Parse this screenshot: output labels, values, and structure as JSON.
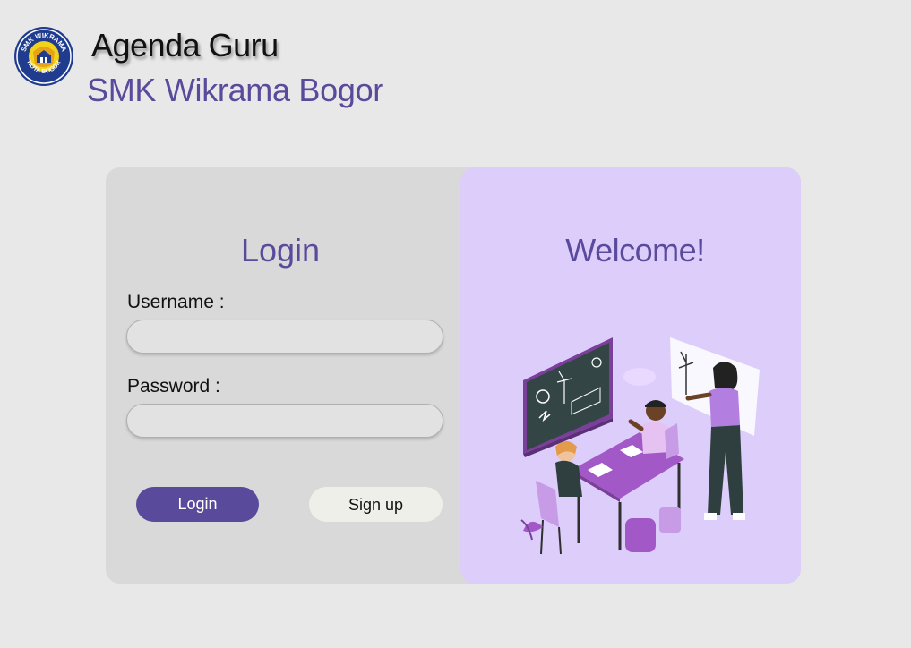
{
  "header": {
    "app_title": "Agenda Guru",
    "school_name": "SMK Wikrama Bogor",
    "logo_top_text": "SMK WIKRAMA",
    "logo_bottom_text": "KOTA BOGOR"
  },
  "login_panel": {
    "heading": "Login",
    "username_label": "Username :",
    "username_value": "",
    "password_label": "Password :",
    "password_value": "",
    "login_button": "Login",
    "signup_button": "Sign up"
  },
  "welcome_panel": {
    "heading": "Welcome!",
    "illustration": "classroom-illustration"
  },
  "colors": {
    "background": "#e8e8e8",
    "brand_purple": "#5a4a9c",
    "welcome_panel": "#dccdfa",
    "login_panel": "#d9d9d9"
  }
}
